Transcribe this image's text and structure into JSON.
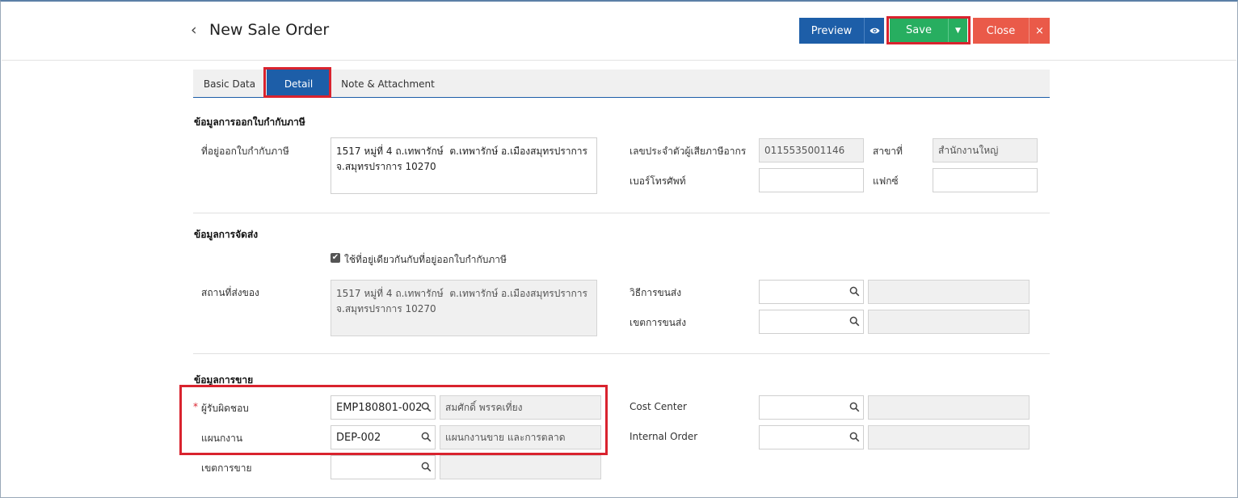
{
  "header": {
    "title": "New Sale Order",
    "back_icon": "‹"
  },
  "toolbar": {
    "preview_label": "Preview",
    "save_label": "Save",
    "close_label": "Close",
    "close_x": "×",
    "caret": "▼"
  },
  "tabs": [
    {
      "label": "Basic Data"
    },
    {
      "label": "Detail"
    },
    {
      "label": "Note & Attachment"
    }
  ],
  "tax": {
    "title": "ข้อมูลการออกใบกำกับภาษี",
    "address_label": "ที่อยู่ออกใบกำกับภาษี",
    "address_value": "1517 หมู่ที่ 4 ถ.เทพารักษ์  ต.เทพารักษ์ อ.เมืองสมุทรปราการ จ.สมุทรปราการ 10270",
    "taxid_label": "เลขประจำตัวผู้เสียภาษีอากร",
    "taxid_value": "0115535001146",
    "branch_label": "สาขาที่",
    "branch_value": "สำนักงานใหญ่",
    "phone_label": "เบอร์โทรศัพท์",
    "phone_value": "",
    "fax_label": "แฟกซ์",
    "fax_value": ""
  },
  "delivery": {
    "title": "ข้อมูลการจัดส่ง",
    "same_address_label": "ใช้ที่อยู่เดียวกันกับที่อยู่ออกใบกำกับภาษี",
    "same_address_checked": true,
    "place_label": "สถานที่ส่งของ",
    "place_value": "1517 หมู่ที่ 4 ถ.เทพารักษ์  ต.เทพารักษ์ อ.เมืองสมุทรปราการ จ.สมุทรปราการ 10270",
    "method_label": "วิธีการขนส่ง",
    "method_value": "",
    "method_name": "",
    "zone_label": "เขตการขนส่ง",
    "zone_value": "",
    "zone_name": ""
  },
  "sales": {
    "title": "ข้อมูลการขาย",
    "required_mark": "*",
    "responsible_label": "ผู้รับผิดชอบ",
    "responsible_code": "EMP180801-002",
    "responsible_name": "สมศักดิ์ พรรคเที่ยง",
    "department_label": "แผนกงาน",
    "department_code": "DEP-002",
    "department_name": "แผนกงานขาย และการตลาด",
    "area_label": "เขตการขาย",
    "area_code": "",
    "area_name": "",
    "cost_center_label": "Cost Center",
    "cost_center_value": "",
    "internal_order_label": "Internal Order",
    "internal_order_value": ""
  },
  "colors": {
    "primary": "#1d5ea8",
    "save": "#27ae60",
    "close": "#ea5a49",
    "highlight": "#d9232e"
  }
}
